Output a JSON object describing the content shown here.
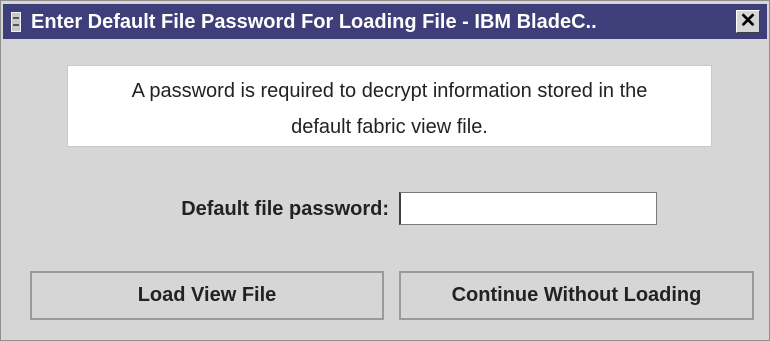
{
  "window": {
    "title": "Enter Default File Password For Loading File - IBM BladeC..",
    "close_symbol": "✕",
    "app_icon": "java-window-icon",
    "close_icon": "close-icon"
  },
  "message": {
    "line1": "A password is required to decrypt information stored in the",
    "line2": "default fabric view file."
  },
  "password": {
    "label": "Default file password:",
    "value": "",
    "placeholder": ""
  },
  "buttons": {
    "load": "Load View File",
    "continue": "Continue Without Loading"
  },
  "colors": {
    "titlebar": "#3e3e7a",
    "dialog_bg": "#d6d6d6",
    "message_bg": "#ffffff"
  }
}
